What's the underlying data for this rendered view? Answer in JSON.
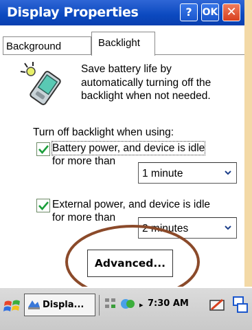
{
  "window": {
    "title": "Display Properties",
    "help_label": "?",
    "ok_label": "OK",
    "close_label": "✕"
  },
  "tabs": [
    {
      "label": "Background",
      "selected": false
    },
    {
      "label": "Backlight",
      "selected": true
    }
  ],
  "backlight": {
    "description_lines": [
      "Save battery life by",
      "automatically turning off the",
      "backlight when not needed."
    ],
    "group_label": "Turn off backlight when using:",
    "battery": {
      "checked": true,
      "line1": "Battery power, and device is idle",
      "line2": "for more than",
      "selected": "1 minute"
    },
    "external": {
      "checked": true,
      "line1": "External power, and device is idle",
      "line2": "for more than",
      "selected": "2 minutes"
    },
    "advanced_label": "Advanced..."
  },
  "taskbar": {
    "task_label": "Displa...",
    "time": "7:30 AM"
  },
  "colors": {
    "titlebar": "#0b49bf",
    "highlight_oval": "#8b4a2a",
    "close_button": "#d8401e",
    "check": "#1a9e3a"
  },
  "icons": [
    "start-icon",
    "display-app-icon",
    "network-icon",
    "sync-icon",
    "keyboard-icon",
    "window-switch-icon",
    "backlight-icon",
    "chevron-down-icon",
    "checkmark-icon"
  ]
}
